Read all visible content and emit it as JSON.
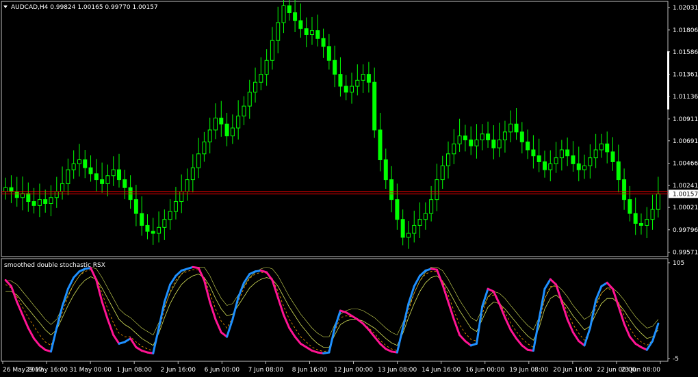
{
  "header": {
    "symbol_line": "AUDCAD,H4  0.99824 1.00165 0.99770 1.00157",
    "indicator_title": "smoothed double stochastic RSX"
  },
  "colors": {
    "background": "#000000",
    "grid_frame": "#c0c0c0",
    "candle": "#00ff00",
    "hline": "#ff0000",
    "price_tag": "#ffffff",
    "rsx_up": "#1e90ff",
    "rsx_down": "#ff1493",
    "signal": "#d4e157",
    "signal_mid": "#ffa000"
  },
  "chart_data": [
    {
      "type": "candlestick",
      "title": "AUDCAD,H4",
      "ohlc_current": {
        "open": 0.99824,
        "high": 1.00165,
        "low": 0.9977,
        "close": 1.00157
      },
      "ylim": [
        0.9954,
        1.0208
      ],
      "y_ticks": [
        "1.02031",
        "1.01806",
        "1.01586",
        "1.01361",
        "1.01136",
        "1.00911",
        "1.00691",
        "1.00466",
        "1.00241",
        "1.00157",
        "1.00021",
        "0.99796",
        "0.99571"
      ],
      "current_price": "1.00157",
      "hlines": [
        1.0018,
        1.00157
      ],
      "closes": [
        1.0022,
        1.0018,
        1.0012,
        1.0016,
        1.0008,
        1.0004,
        1.001,
        1.0006,
        1.0012,
        1.0018,
        1.0026,
        1.004,
        1.0046,
        1.005,
        1.0042,
        1.0036,
        1.003,
        1.0026,
        1.0034,
        1.004,
        1.003,
        1.0022,
        1.001,
        0.9996,
        0.9984,
        0.9978,
        0.9976,
        0.9982,
        0.999,
        0.9998,
        1.0008,
        1.0018,
        1.003,
        1.0042,
        1.0056,
        1.0068,
        1.008,
        1.0092,
        1.0086,
        1.0074,
        1.0082,
        1.0094,
        1.0104,
        1.0118,
        1.0128,
        1.0136,
        1.015,
        1.017,
        1.0188,
        1.0205,
        1.0198,
        1.019,
        1.0182,
        1.0176,
        1.018,
        1.0172,
        1.0164,
        1.015,
        1.0136,
        1.0124,
        1.0118,
        1.0124,
        1.013,
        1.0136,
        1.0128,
        1.008,
        1.005,
        1.003,
        1.001,
        0.999,
        0.9972,
        0.9976,
        0.9984,
        0.999,
        0.9996,
        1.001,
        1.003,
        1.0044,
        1.0056,
        1.0066,
        1.0074,
        1.007,
        1.0064,
        1.007,
        1.0076,
        1.007,
        1.0062,
        1.007,
        1.0078,
        1.0086,
        1.0078,
        1.0068,
        1.006,
        1.0054,
        1.0048,
        1.004,
        1.0046,
        1.0052,
        1.006,
        1.0054,
        1.0046,
        1.004,
        1.0044,
        1.0052,
        1.006,
        1.0066,
        1.0058,
        1.0048,
        1.003,
        1.001,
        0.9996,
        0.9986,
        0.9984,
        0.999,
        1.0,
        1.00157
      ],
      "xlim_bars": 118,
      "x_ticks": [
        "26 May 2017",
        "29 May 16:00",
        "31 May 00:00",
        "1 Jun 08:00",
        "2 Jun 16:00",
        "6 Jun 00:00",
        "7 Jun 08:00",
        "8 Jun 16:00",
        "12 Jun 00:00",
        "13 Jun 08:00",
        "14 Jun 16:00",
        "16 Jun 00:00",
        "19 Jun 08:00",
        "20 Jun 16:00",
        "22 Jun 00:00",
        "23 Jun 08:00"
      ]
    },
    {
      "type": "line",
      "title": "smoothed double stochastic RSX",
      "ylim": [
        -5,
        105
      ],
      "y_ticks": [
        "105",
        "-5"
      ],
      "series": [
        {
          "values": [
            85,
            78,
            60,
            45,
            30,
            18,
            10,
            5,
            3,
            30,
            55,
            75,
            88,
            95,
            98,
            99,
            85,
            60,
            40,
            22,
            12,
            14,
            18,
            8,
            4,
            2,
            1,
            30,
            60,
            80,
            90,
            96,
            98,
            100,
            99,
            85,
            60,
            40,
            25,
            20,
            40,
            65,
            82,
            92,
            95,
            96,
            94,
            85,
            65,
            45,
            30,
            20,
            12,
            8,
            4,
            2,
            1,
            2,
            30,
            50,
            48,
            44,
            40,
            35,
            28,
            20,
            12,
            6,
            3,
            2,
            30,
            58,
            78,
            90,
            96,
            98,
            97,
            80,
            60,
            40,
            22,
            15,
            10,
            12,
            55,
            75,
            72,
            58,
            42,
            28,
            18,
            10,
            5,
            4,
            40,
            75,
            86,
            80,
            60,
            40,
            25,
            15,
            10,
            30,
            62,
            78,
            82,
            75,
            55,
            35,
            20,
            12,
            8,
            5,
            15,
            35
          ]
        },
        {
          "values": [
            80,
            76,
            66,
            54,
            42,
            32,
            22,
            14,
            10,
            28,
            48,
            66,
            80,
            90,
            95,
            97,
            88,
            70,
            52,
            36,
            24,
            20,
            20,
            14,
            9,
            6,
            4,
            26,
            52,
            72,
            85,
            92,
            95,
            97,
            97,
            88,
            70,
            52,
            38,
            30,
            42,
            60,
            76,
            87,
            92,
            94,
            93,
            87,
            72,
            55,
            40,
            30,
            20,
            14,
            8,
            5,
            3,
            4,
            26,
            42,
            44,
            43,
            40,
            36,
            30,
            24,
            16,
            10,
            6,
            4,
            26,
            50,
            70,
            84,
            92,
            95,
            95,
            84,
            68,
            50,
            34,
            24,
            17,
            15,
            46,
            66,
            68,
            60,
            48,
            36,
            26,
            18,
            12,
            8,
            34,
            64,
            78,
            78,
            64,
            48,
            34,
            24,
            16,
            28,
            54,
            70,
            76,
            72,
            60,
            44,
            30,
            20,
            14,
            10,
            16,
            30
          ]
        },
        {
          "values": [
            72,
            72,
            68,
            60,
            52,
            44,
            36,
            28,
            22,
            28,
            42,
            56,
            68,
            78,
            85,
            89,
            86,
            76,
            64,
            52,
            40,
            34,
            30,
            24,
            18,
            14,
            10,
            24,
            42,
            58,
            70,
            80,
            86,
            90,
            92,
            88,
            78,
            64,
            52,
            44,
            46,
            56,
            66,
            76,
            82,
            86,
            88,
            86,
            78,
            66,
            54,
            44,
            34,
            26,
            18,
            12,
            8,
            8,
            22,
            34,
            38,
            40,
            40,
            38,
            34,
            30,
            24,
            18,
            13,
            10,
            24,
            42,
            58,
            72,
            82,
            88,
            90,
            84,
            74,
            62,
            50,
            40,
            30,
            26,
            40,
            54,
            60,
            58,
            52,
            44,
            36,
            28,
            21,
            16,
            30,
            52,
            64,
            68,
            62,
            54,
            44,
            36,
            28,
            32,
            46,
            58,
            64,
            64,
            58,
            50,
            40,
            31,
            24,
            18,
            20,
            28
          ]
        }
      ]
    }
  ]
}
